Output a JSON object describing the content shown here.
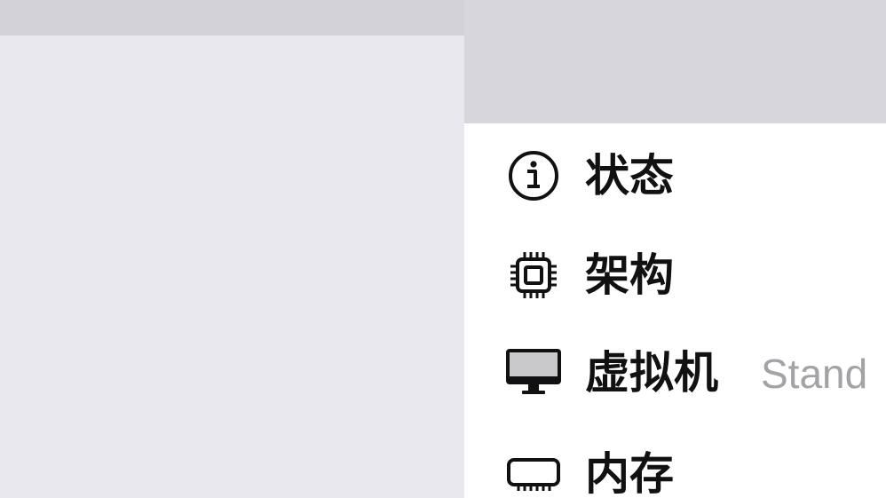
{
  "settings_menu": {
    "items": [
      {
        "label": "状态",
        "icon": "info-circle-icon"
      },
      {
        "label": "架构",
        "icon": "cpu-chip-icon"
      },
      {
        "label": "虚拟机",
        "icon": "monitor-icon",
        "detail": "Stand"
      },
      {
        "label": "内存",
        "icon": "memory-module-icon"
      }
    ]
  }
}
